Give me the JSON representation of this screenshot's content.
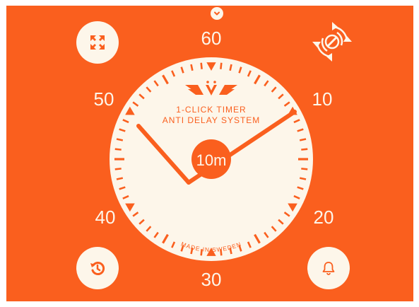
{
  "colors": {
    "background": "#fa5f1e",
    "face": "#fdf6ea",
    "accent": "#fa5f1e"
  },
  "top": {
    "chevron_icon": "chevron-down-icon"
  },
  "buttons": {
    "expand_icon": "expand-arrows-icon",
    "sync_icon": "rotate-sync-icon",
    "history_icon": "history-restore-icon",
    "bell_icon": "bell-icon"
  },
  "dial_numbers": {
    "n60": "60",
    "n10": "10",
    "n20": "20",
    "n30": "30",
    "n40": "40",
    "n50": "50"
  },
  "face": {
    "brand_line1": "1-CLICK TIMER",
    "brand_line2": "ANTI DELAY SYSTEM",
    "made_in": "MADE IN SWEDEN",
    "center_readout": "10m"
  },
  "timer": {
    "set_minutes": 10
  }
}
